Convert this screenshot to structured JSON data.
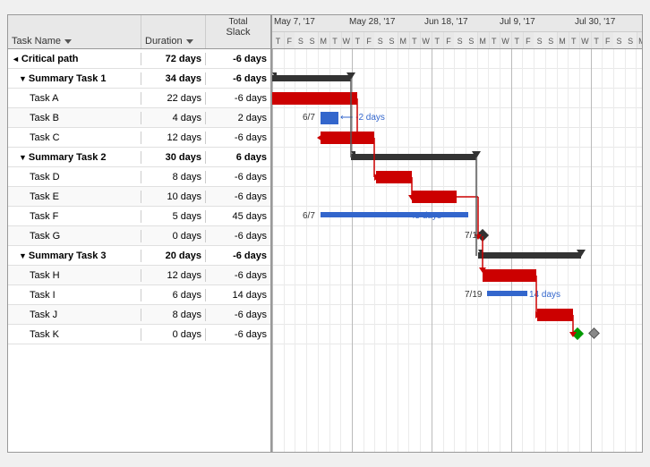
{
  "header": {
    "col_task": "Task Name",
    "col_duration": "Duration",
    "col_slack_top": "Total",
    "col_slack_bottom": "Slack"
  },
  "rows": [
    {
      "id": "critical-path",
      "label": "Critical path",
      "indent": 0,
      "type": "root",
      "duration": "72 days",
      "slack": "-6 days",
      "bold": true
    },
    {
      "id": "summary1",
      "label": "Summary Task 1",
      "indent": 1,
      "type": "summary",
      "duration": "34 days",
      "slack": "-6 days",
      "bold": true
    },
    {
      "id": "taskA",
      "label": "Task A",
      "indent": 2,
      "type": "task",
      "duration": "22 days",
      "slack": "-6 days",
      "bold": false
    },
    {
      "id": "taskB",
      "label": "Task B",
      "indent": 2,
      "type": "task",
      "duration": "4 days",
      "slack": "2 days",
      "bold": false
    },
    {
      "id": "taskC",
      "label": "Task C",
      "indent": 2,
      "type": "task",
      "duration": "12 days",
      "slack": "-6 days",
      "bold": false
    },
    {
      "id": "summary2",
      "label": "Summary Task 2",
      "indent": 1,
      "type": "summary",
      "duration": "30 days",
      "slack": "6 days",
      "bold": true
    },
    {
      "id": "taskD",
      "label": "Task D",
      "indent": 2,
      "type": "task",
      "duration": "8 days",
      "slack": "-6 days",
      "bold": false
    },
    {
      "id": "taskE",
      "label": "Task E",
      "indent": 2,
      "type": "task",
      "duration": "10 days",
      "slack": "-6 days",
      "bold": false
    },
    {
      "id": "taskF",
      "label": "Task F",
      "indent": 2,
      "type": "task",
      "duration": "5 days",
      "slack": "45 days",
      "bold": false
    },
    {
      "id": "taskG",
      "label": "Task G",
      "indent": 2,
      "type": "task",
      "duration": "0 days",
      "slack": "-6 days",
      "bold": false
    },
    {
      "id": "summary3",
      "label": "Summary Task 3",
      "indent": 1,
      "type": "summary",
      "duration": "20 days",
      "slack": "-6 days",
      "bold": true
    },
    {
      "id": "taskH",
      "label": "Task H",
      "indent": 2,
      "type": "task",
      "duration": "12 days",
      "slack": "-6 days",
      "bold": false
    },
    {
      "id": "taskI",
      "label": "Task I",
      "indent": 2,
      "type": "task",
      "duration": "6 days",
      "slack": "14 days",
      "bold": false
    },
    {
      "id": "taskJ",
      "label": "Task J",
      "indent": 2,
      "type": "task",
      "duration": "8 days",
      "slack": "-6 days",
      "bold": false
    },
    {
      "id": "taskK",
      "label": "Task K",
      "indent": 2,
      "type": "task",
      "duration": "0 days",
      "slack": "-6 days",
      "bold": false
    }
  ],
  "timeline": {
    "dates_top": [
      "May 7, '17",
      "May 28, '17",
      "Jun 18, '17",
      "Jul 9, '17",
      "Jul 30, '17"
    ],
    "days_bottom": [
      "T",
      "F",
      "S",
      "S",
      "M",
      "T",
      "W",
      "T",
      "F",
      "S",
      "S",
      "M",
      "T",
      "W",
      "T",
      "F",
      "S",
      "S",
      "M",
      "T",
      "W",
      "T",
      "F",
      "S",
      "S",
      "M",
      "T",
      "W",
      "T",
      "F",
      "S",
      "S",
      "M"
    ]
  },
  "bars": {
    "taskA_label": "",
    "taskB_label": "6/7",
    "taskB_slack": "-2 days",
    "taskF_label": "6/7",
    "taskF_slack": "45 days",
    "taskG_label": "7/18",
    "taskI_label": "7/19",
    "taskI_slack": "14 days"
  }
}
